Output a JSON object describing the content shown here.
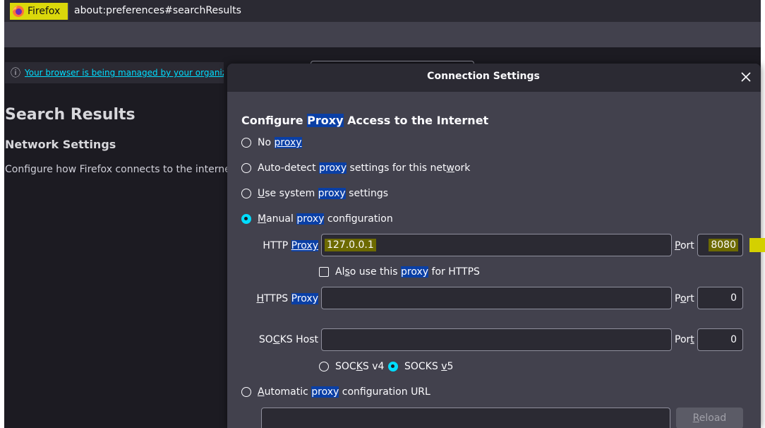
{
  "browser": {
    "identity_label": "Firefox",
    "url": "about:preferences#searchResults"
  },
  "page": {
    "policy_notice": "Your browser is being managed by your organization",
    "search_results_title": "Search Results",
    "network_settings_title": "Network Settings",
    "network_settings_desc": "Configure how Firefox connects to the internet."
  },
  "dialog": {
    "title": "Connection Settings",
    "section_title": {
      "a": "Configure ",
      "b": "Proxy",
      "c": " Access to the Internet"
    },
    "options": {
      "no_proxy": {
        "a": "No ",
        "b": "proxy"
      },
      "auto_detect": {
        "a": "Auto-detect ",
        "b": "proxy",
        "c": " settings for this net",
        "d": "w",
        "e": "ork"
      },
      "system": {
        "a": "U",
        "b": "se system ",
        "c": "proxy",
        "d": " settings"
      },
      "manual": {
        "a": "M",
        "b": "anual ",
        "c": "proxy",
        "d": " configuration"
      },
      "auto_url": {
        "a": "A",
        "b": "utomatic ",
        "c": "proxy",
        "d": " configuration URL"
      }
    },
    "http": {
      "label_a": "HTTP ",
      "label_b": "Proxy",
      "value": "127.0.0.1",
      "port_label_a": "P",
      "port_label_b": "ort",
      "port": "8080"
    },
    "also_https": {
      "a": "Al",
      "b": "s",
      "c": "o use this ",
      "d": "proxy",
      "e": " for HTTPS"
    },
    "https": {
      "label_a": "H",
      "label_b": "TTPS ",
      "label_c": "Proxy",
      "value": "",
      "port_label_a": "P",
      "port_label_b": "o",
      "port_label_c": "rt",
      "port": "0"
    },
    "socks": {
      "label_a": "SO",
      "label_b": "C",
      "label_c": "KS Host",
      "value": "",
      "port_label_a": "Por",
      "port_label_b": "t",
      "port": "0",
      "v4_a": "SOC",
      "v4_b": "K",
      "v4_c": "S v4",
      "v5_a": "SOCKS ",
      "v5_b": "v",
      "v5_c": "5"
    },
    "reload": {
      "a": "R",
      "b": "eload"
    }
  },
  "colors": {
    "accent": "#00ddff",
    "highlight": "#0a3fa5",
    "dialog_bg": "#42414d"
  },
  "icons": [
    "firefox-icon",
    "info-icon",
    "close-icon"
  ]
}
